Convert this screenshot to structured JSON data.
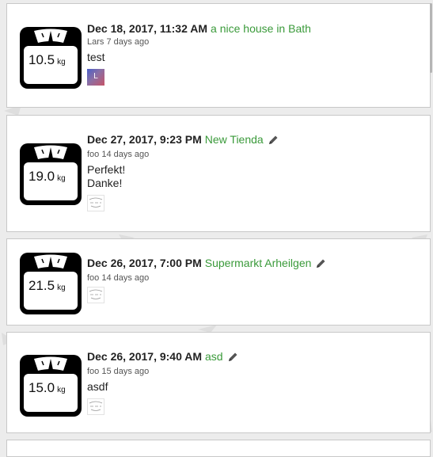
{
  "entries": [
    {
      "weight": "10.5",
      "unit": "kg",
      "datetime": "Dec 18, 2017, 11:32 AM",
      "place": "a nice house in Bath",
      "author_line": "Lars 7 days ago",
      "note": "test",
      "thumb_letter": "L",
      "editable": false
    },
    {
      "weight": "19.0",
      "unit": "kg",
      "datetime": "Dec 27, 2017, 9:23 PM",
      "place": "New Tienda",
      "author_line": "foo 14 days ago",
      "note": "Perfekt!\nDanke!",
      "editable": true
    },
    {
      "weight": "21.5",
      "unit": "kg",
      "datetime": "Dec 26, 2017, 7:00 PM",
      "place": "Supermarkt Arheilgen",
      "author_line": "foo 14 days ago",
      "note": "",
      "editable": true
    },
    {
      "weight": "15.0",
      "unit": "kg",
      "datetime": "Dec 26, 2017, 9:40 AM",
      "place": "asd",
      "author_line": "foo 15 days ago",
      "note": "asdf",
      "editable": true
    }
  ],
  "colors": {
    "place_link": "#3a9a3a",
    "scale_icon": "#000000",
    "card_border": "#c8c8c8",
    "page_background": "#ececec"
  },
  "icons": [
    "scale-icon",
    "pencil-icon",
    "user-avatar",
    "sketch-thumbnail"
  ]
}
